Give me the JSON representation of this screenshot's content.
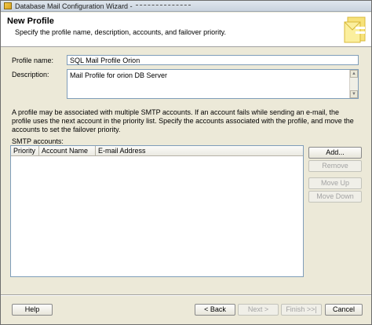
{
  "window": {
    "title": "Database Mail Configuration Wizard -"
  },
  "header": {
    "title": "New Profile",
    "subtitle": "Specify the profile name, description, accounts, and failover priority."
  },
  "form": {
    "profile_name_label": "Profile name:",
    "profile_name_value": "SQL Mail Profile Orion",
    "description_label": "Description:",
    "description_value": "Mail Profile for orion DB Server"
  },
  "info_text": "A profile may be associated with multiple SMTP accounts. If an account fails while sending an e-mail, the profile uses the next account in the priority list. Specify the accounts associated with the profile, and move the accounts to set the failover priority.",
  "smtp": {
    "label": "SMTP accounts:",
    "columns": [
      "Priority",
      "Account Name",
      "E-mail Address"
    ]
  },
  "side_buttons": {
    "add": "Add...",
    "remove": "Remove",
    "move_up": "Move Up",
    "move_down": "Move Down"
  },
  "footer": {
    "help": "Help",
    "back": "< Back",
    "next": "Next >",
    "finish": "Finish >>|",
    "cancel": "Cancel"
  },
  "colors": {
    "dialog_bg": "#ece9d8",
    "field_border": "#7f9db9",
    "disabled_text": "#a3a3a3"
  }
}
